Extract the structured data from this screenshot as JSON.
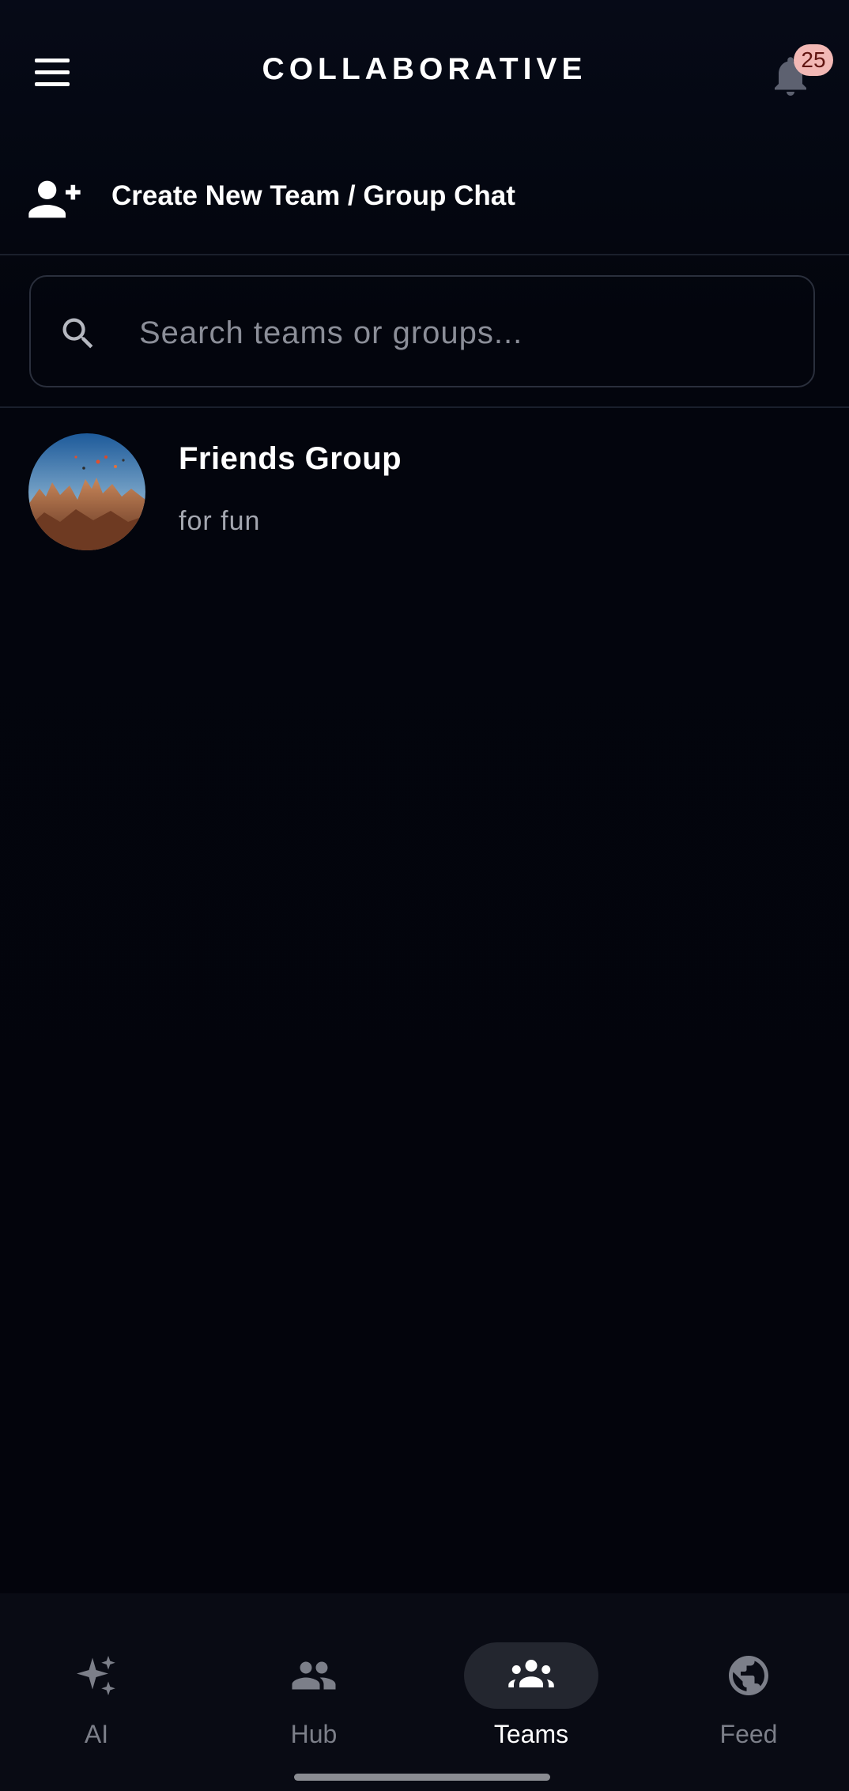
{
  "header": {
    "title": "COLLABORATIVE",
    "notification_count": "25",
    "menu_icon": "hamburger-menu-icon",
    "bell_icon": "bell-icon"
  },
  "create_team": {
    "icon": "add-person-icon",
    "label": "Create New Team / Group Chat"
  },
  "search": {
    "placeholder": "Search teams or groups...",
    "value": "",
    "icon": "search-icon"
  },
  "teams": [
    {
      "name": "Friends Group",
      "description": "for fun",
      "avatar": "hot-air-balloons-landscape-photo"
    }
  ],
  "bottom_nav": {
    "items": [
      {
        "label": "AI",
        "icon": "sparkles-icon",
        "active": false
      },
      {
        "label": "Hub",
        "icon": "people-icon",
        "active": false
      },
      {
        "label": "Teams",
        "icon": "groups-icon",
        "active": true
      },
      {
        "label": "Feed",
        "icon": "globe-icon",
        "active": false
      }
    ]
  },
  "colors": {
    "background": "#03050e",
    "nav_background": "#090b14",
    "active_pill": "#23262f",
    "badge": "#f2b8b5",
    "inactive_text": "#7c7f89"
  }
}
